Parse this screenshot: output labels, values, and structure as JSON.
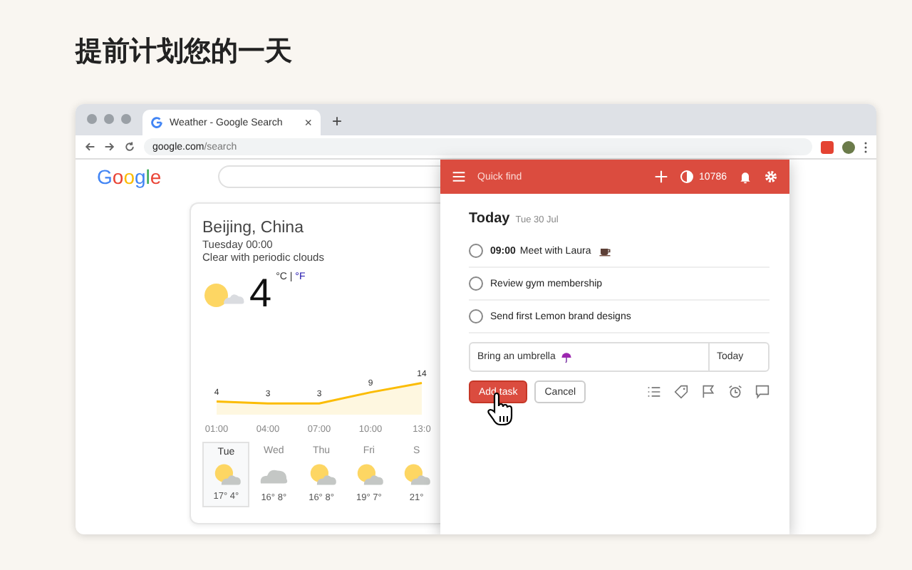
{
  "heading": "提前计划您的一天",
  "browser": {
    "tab_title": "Weather - Google Search",
    "tab_close": "×",
    "new_tab": "+",
    "url_host": "google.com",
    "url_path": "/search"
  },
  "google": {
    "logo": "Google"
  },
  "weather": {
    "location": "Beijing, China",
    "time": "Tuesday 00:00",
    "condition": "Clear with periodic clouds",
    "temperature": "4",
    "unit_c": "°C",
    "unit_sep": "|",
    "unit_f": "°F",
    "chart_data": {
      "type": "area",
      "categories": [
        "01:00",
        "04:00",
        "07:00",
        "10:00",
        "13:0"
      ],
      "series": [
        {
          "color": "#fbbc04",
          "values": [
            4,
            3,
            3,
            9,
            14
          ]
        }
      ],
      "data_labels": true
    },
    "days": [
      {
        "day": "Tue",
        "temps": "17° 4°",
        "kind": "partly-cloudy",
        "selected": true
      },
      {
        "day": "Wed",
        "temps": "16° 8°",
        "kind": "cloudy",
        "selected": false
      },
      {
        "day": "Thu",
        "temps": "16° 8°",
        "kind": "partly-cloudy",
        "selected": false
      },
      {
        "day": "Fri",
        "temps": "19° 7°",
        "kind": "partly-cloudy",
        "selected": false
      },
      {
        "day": "S",
        "temps": "21°",
        "kind": "partly-cloudy",
        "selected": false
      }
    ]
  },
  "todoist": {
    "search": "Quick find",
    "karma": "10786",
    "section": "Today",
    "date": "Tue 30 Jul",
    "tasks": [
      {
        "time": "09:00",
        "text": "Meet with Laura",
        "checked": false,
        "kind": "coffee"
      },
      {
        "text": "Review gym membership",
        "checked": false
      },
      {
        "text": "Send first Lemon brand designs",
        "checked": false
      }
    ],
    "new_task": {
      "value": "Bring an umbrella",
      "due": "Today"
    },
    "buttons": [
      "Add task",
      "Cancel"
    ]
  }
}
